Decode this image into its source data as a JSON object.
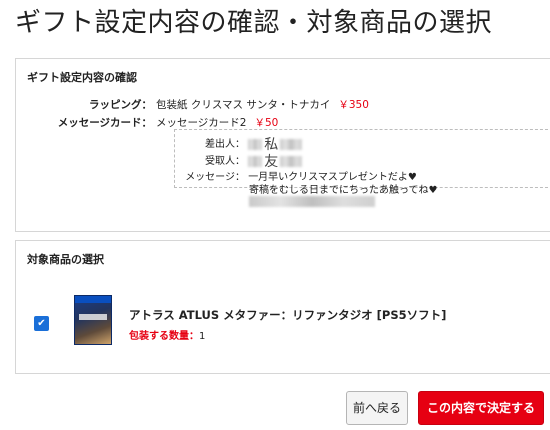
{
  "page": {
    "title": "ギフト設定内容の確認・対象商品の選択"
  },
  "gift_panel": {
    "heading": "ギフト設定内容の確認",
    "wrapping": {
      "label": "ラッピング：",
      "value": "包装紙 クリスマス サンタ・トナカイ",
      "price": "￥350"
    },
    "message_card": {
      "label": "メッセージカード：",
      "value": "メッセージカード2",
      "price": "￥50"
    },
    "message": {
      "sender_label": "差出人：",
      "sender_visible": "私",
      "recipient_label": "受取人：",
      "recipient_visible": "友",
      "message_label": "メッセージ：",
      "line1": "一月早いクリスマスプレゼントだよ",
      "line2": "寄稿をむしる日までにちったあ触ってね",
      "heart": "♥"
    }
  },
  "target_panel": {
    "heading": "対象商品の選択",
    "product": {
      "checked": true,
      "check_glyph": "✔",
      "title": "アトラス ATLUS メタファー：リファンタジオ [PS5ソフト]",
      "qty_label": "包装する数量：",
      "qty_value": "1"
    }
  },
  "buttons": {
    "back": "前へ戻る",
    "confirm": "この内容で決定する"
  },
  "colors": {
    "accent_red": "#e60012",
    "checkbox_blue": "#1a6fd8"
  }
}
